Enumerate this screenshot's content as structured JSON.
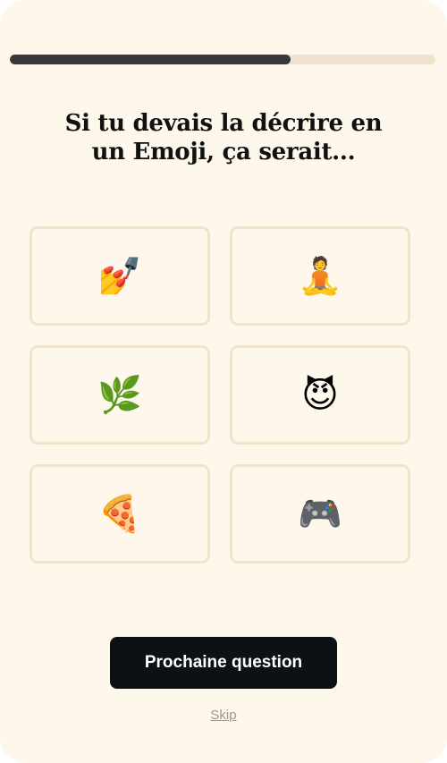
{
  "progress": {
    "fraction": 0.66
  },
  "question": {
    "line1": "Si tu devais la décrire en",
    "line2": "un Emoji, ça serait..."
  },
  "options": [
    {
      "emoji": "💅",
      "icon": "nail-polish-icon"
    },
    {
      "emoji": "🧘",
      "icon": "meditation-icon"
    },
    {
      "emoji": "🌿",
      "icon": "herb-icon"
    },
    {
      "emoji": "😈",
      "icon": "smiling-devil-icon"
    },
    {
      "emoji": "🍕",
      "icon": "pizza-icon"
    },
    {
      "emoji": "🎮",
      "icon": "game-controller-icon"
    }
  ],
  "actions": {
    "next_label": "Prochaine question",
    "skip_label": "Skip"
  },
  "colors": {
    "background": "#fdf7ec",
    "progress_fill": "#363839",
    "progress_track": "#efe3cd",
    "option_border": "#f1e4cb",
    "button_bg": "#0e1114"
  }
}
